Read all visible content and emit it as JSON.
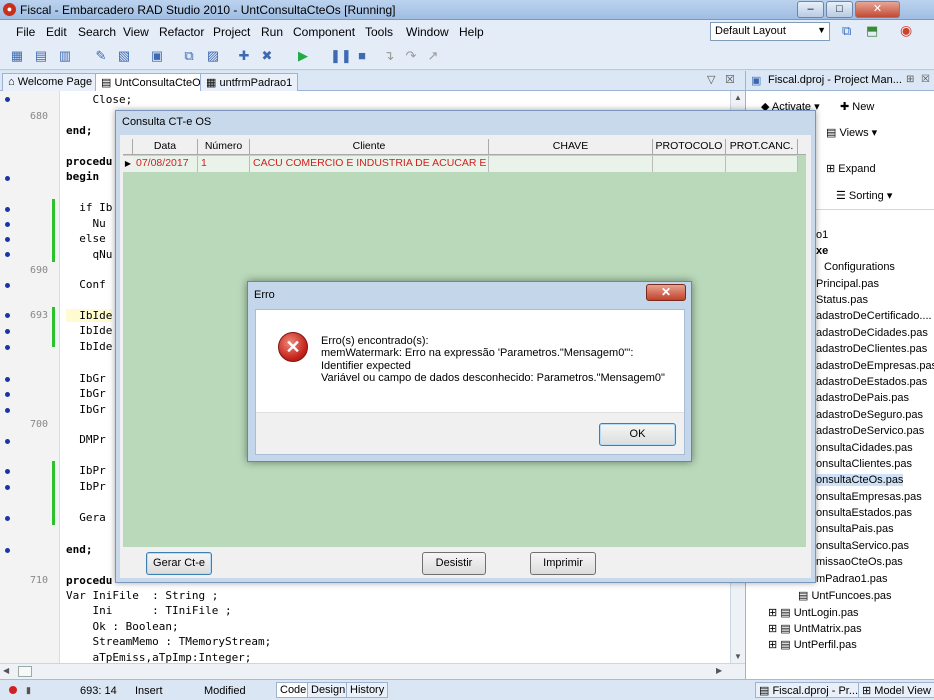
{
  "window": {
    "title": "Fiscal - Embarcadero RAD Studio 2010 - UntConsultaCteOs [Running]",
    "app_icon": "rad-studio-icon"
  },
  "menu": [
    "File",
    "Edit",
    "Search",
    "View",
    "Refactor",
    "Project",
    "Run",
    "Component",
    "Tools",
    "Window",
    "Help"
  ],
  "layout_combo": {
    "value": "Default Layout"
  },
  "tabs": [
    "Welcome Page",
    "UntConsultaCteOs",
    "untfrmPadrao1"
  ],
  "editor": {
    "line_numbers": [
      "680",
      "690",
      "693",
      "700",
      "710"
    ],
    "lines": [
      "    Close;",
      "end;",
      "procedu",
      "begin",
      "  if Ib",
      "    Nu",
      "  else",
      "    qNu",
      "  Conf",
      "  IbIde",
      "  IbIde",
      "  IbIde",
      "  IbGr",
      "  IbGr",
      "  IbGr",
      "  DMPr",
      "  IbPr",
      "  IbPr",
      "  Gera",
      "end;",
      "procedu",
      "Var IniFile  : String ;",
      "    Ini      : TIniFile ;",
      "    Ok : Boolean;",
      "    StreamMemo : TMemoryStream;",
      "    aTpEmiss,aTpImp:Integer;"
    ]
  },
  "status": {
    "position": "693: 14",
    "mode": "Insert",
    "state": "Modified",
    "view_tabs": [
      "Code",
      "Design",
      "History"
    ]
  },
  "right_panel": {
    "title": "Fiscal.dproj - Project Man...",
    "tools": {
      "activate": "Activate",
      "new": "New",
      "views": "Views",
      "expand": "Expand",
      "sorting": "Sorting"
    },
    "items": [
      "o1",
      "xe",
      "Configurations",
      "Principal.pas",
      "Status.pas",
      "adastroDeCertificado....",
      "adastroDeCidades.pas",
      "adastroDeClientes.pas",
      "adastroDeEmpresas.pas",
      "adastroDeEstados.pas",
      "adastroDePais.pas",
      "adastroDeSeguro.pas",
      "adastroDeServico.pas",
      "onsultaCidades.pas",
      "onsultaClientes.pas",
      "onsultaCteOs.pas",
      "onsultaEmpresas.pas",
      "onsultaEstados.pas",
      "onsultaPais.pas",
      "onsultaServico.pas",
      "missaoCteOs.pas",
      "mPadrao1.pas",
      "UntFuncoes.pas",
      "UntLogin.pas",
      "UntMatrix.pas",
      "UntPerfil.pas"
    ],
    "bottom_tabs": [
      "Fiscal.dproj - Pr...",
      "Model View"
    ]
  },
  "consulta": {
    "title": "Consulta CT-e OS",
    "columns": [
      "Data",
      "Número",
      "Cliente",
      "CHAVE",
      "PROTOCOLO",
      "PROT.CANC."
    ],
    "rows": [
      [
        "07/08/2017",
        "1",
        "CACU COMERCIO E INDUSTRIA DE ACUCAR E ALCOC",
        "",
        "",
        ""
      ]
    ],
    "buttons": {
      "gerar": "Gerar Ct-e",
      "desistir": "Desistir",
      "imprimir": "Imprimir"
    }
  },
  "erro": {
    "title": "Erro",
    "icon": "error-icon",
    "lines": [
      "Erro(s) encontrado(s):",
      "memWatermark: Erro na expressão 'Parametros.\"Mensagem0\"':",
      "Identifier expected",
      "Variável ou campo de dados desconhecido: Parametros.\"Mensagem0\""
    ],
    "ok": "OK"
  }
}
